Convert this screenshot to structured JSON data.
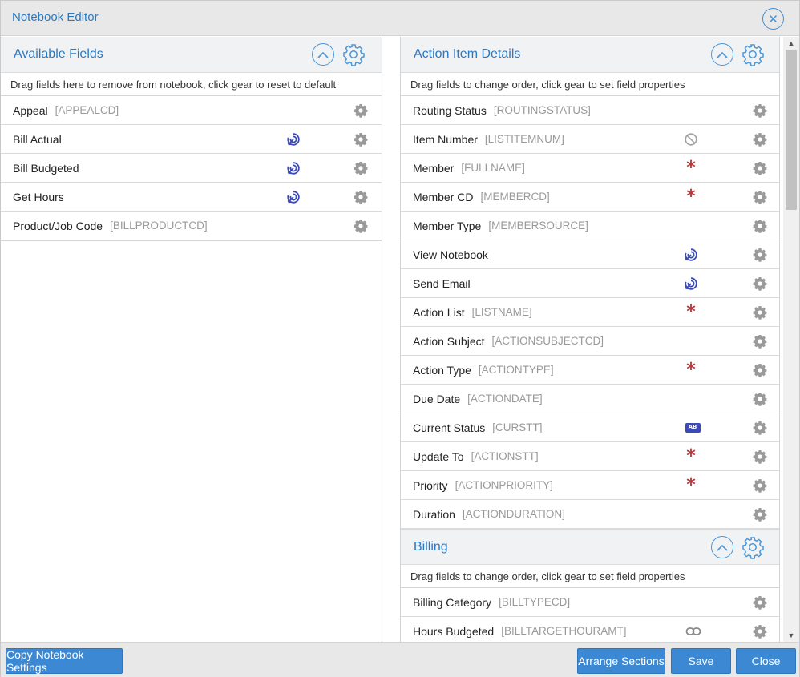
{
  "dialog": {
    "title": "Notebook Editor"
  },
  "available": {
    "title": "Available Fields",
    "hint": "Drag fields here to remove from notebook, click gear to reset to default",
    "rows": [
      {
        "label": "Appeal",
        "code": "[APPEALCD]",
        "flag": ""
      },
      {
        "label": "Bill Actual",
        "code": "",
        "flag": "target-icon"
      },
      {
        "label": "Bill Budgeted",
        "code": "",
        "flag": "target-icon"
      },
      {
        "label": "Get Hours",
        "code": "",
        "flag": "target-icon"
      },
      {
        "label": "Product/Job Code",
        "code": "[BILLPRODUCTCD]",
        "flag": ""
      }
    ]
  },
  "action_items": {
    "title": "Action Item Details",
    "hint": "Drag fields to change order, click gear to set field properties",
    "rows": [
      {
        "label": "Routing Status",
        "code": "[ROUTINGSTATUS]",
        "flag": ""
      },
      {
        "label": "Item Number",
        "code": "[LISTITEMNUM]",
        "flag": "no-entry-icon"
      },
      {
        "label": "Member",
        "code": "[FULLNAME]",
        "flag": "required-icon"
      },
      {
        "label": "Member CD",
        "code": "[MEMBERCD]",
        "flag": "required-icon"
      },
      {
        "label": "Member Type",
        "code": "[MEMBERSOURCE]",
        "flag": ""
      },
      {
        "label": "View Notebook",
        "code": "",
        "flag": "target-icon"
      },
      {
        "label": "Send Email",
        "code": "",
        "flag": "target-icon"
      },
      {
        "label": "Action List",
        "code": "[LISTNAME]",
        "flag": "required-icon"
      },
      {
        "label": "Action Subject",
        "code": "[ACTIONSUBJECTCD]",
        "flag": ""
      },
      {
        "label": "Action Type",
        "code": "[ACTIONTYPE]",
        "flag": "required-icon"
      },
      {
        "label": "Due Date",
        "code": "[ACTIONDATE]",
        "flag": ""
      },
      {
        "label": "Current Status",
        "code": "[CURSTT]",
        "flag": "ab-icon"
      },
      {
        "label": "Update To",
        "code": "[ACTIONSTT]",
        "flag": "required-icon"
      },
      {
        "label": "Priority",
        "code": "[ACTIONPRIORITY]",
        "flag": "required-icon"
      },
      {
        "label": "Duration",
        "code": "[ACTIONDURATION]",
        "flag": ""
      }
    ]
  },
  "billing": {
    "title": "Billing",
    "hint": "Drag fields to change order, click gear to set field properties",
    "rows": [
      {
        "label": "Billing Category",
        "code": "[BILLTYPECD]",
        "flag": ""
      },
      {
        "label": "Hours Budgeted",
        "code": "[BILLTARGETHOURAMT]",
        "flag": "link-icon"
      }
    ]
  },
  "footer": {
    "copy_label": "Copy Notebook Settings",
    "arrange_label": "Arrange Sections",
    "save_label": "Save",
    "close_label": "Close"
  },
  "ab_text": "AB",
  "close_glyph": "✕",
  "colors": {
    "accent": "#2a78c2",
    "button": "#3d88d3",
    "required": "#b5383b",
    "flag_icon": "#3b4ab8"
  }
}
